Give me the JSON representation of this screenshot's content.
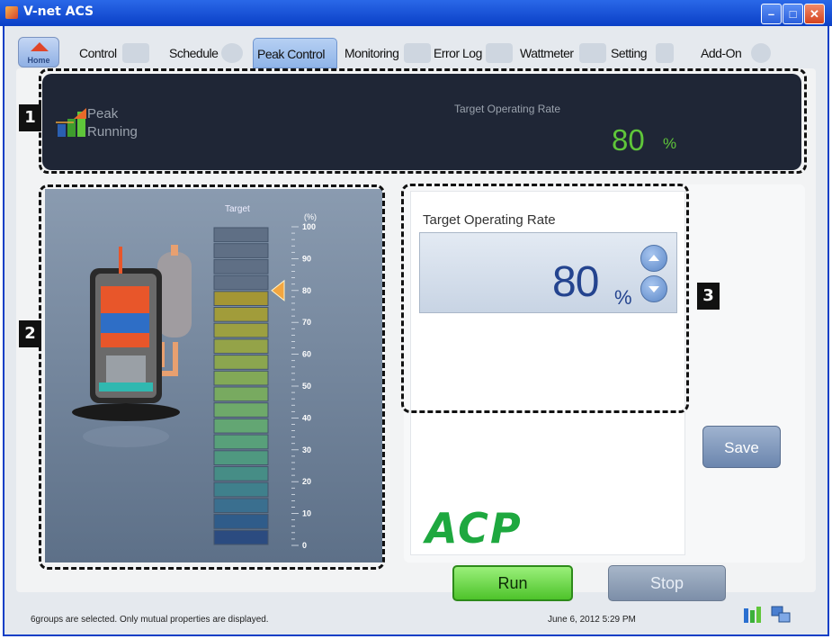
{
  "window": {
    "title": "V-net ACS",
    "minimize": "–",
    "maximize": "□",
    "close": "✕"
  },
  "tabs": {
    "home": "Home",
    "items": [
      "Control",
      "Schedule",
      "Peak Control",
      "Monitoring",
      "Error Log",
      "Wattmeter",
      "Setting",
      "Add-On"
    ],
    "active": "Peak Control"
  },
  "callouts": [
    "1",
    "2",
    "3"
  ],
  "status_panel": {
    "label_line1": "Peak",
    "label_line2": "Running",
    "rate_title": "Target Operating Rate",
    "rate_value": "80",
    "rate_unit": "%"
  },
  "gauge": {
    "target_label": "Target",
    "unit_label": "(%)",
    "ticks": [
      "100",
      "90",
      "80",
      "70",
      "60",
      "50",
      "40",
      "30",
      "20",
      "10",
      "0"
    ],
    "target_value": 80
  },
  "rate_control": {
    "label": "Target Operating Rate",
    "value": "80",
    "unit": "%"
  },
  "buttons": {
    "save": "Save",
    "run": "Run",
    "stop": "Stop"
  },
  "brand": {
    "logo_text": "ACP",
    "logo_color": "#1ea83f"
  },
  "status_bar": {
    "message": "6groups are selected. Only mutual properties are displayed.",
    "datetime": "June 6, 2012  5:29 PM"
  },
  "colors": {
    "accent_green": "#5fc63a",
    "rate_blue": "#24448f",
    "panel_dark": "#1f2636"
  }
}
